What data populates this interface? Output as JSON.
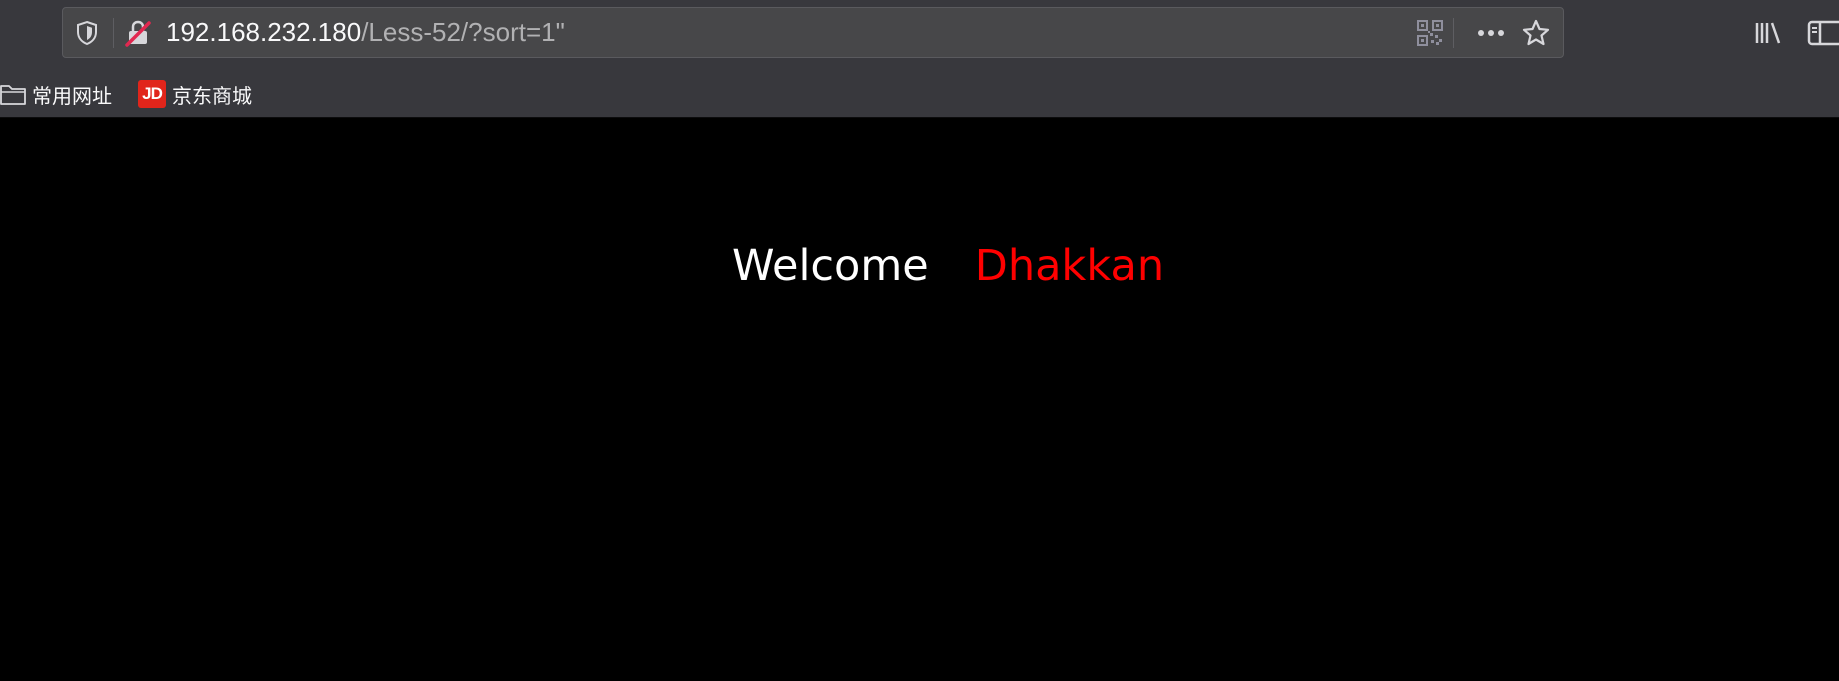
{
  "browser": {
    "url_host": "192.168.232.180",
    "url_path": "/Less-52/?sort=1\"",
    "icons": {
      "tracking_protection": "shield-icon",
      "insecure_connection": "lock-crossed-icon",
      "qr_code": "qr-code-icon",
      "page_actions": "more-icon",
      "bookmark_star": "star-icon",
      "library": "library-icon",
      "sidebar": "sidebar-icon"
    }
  },
  "bookmarks": [
    {
      "label": "常用网址",
      "icon": "folder-icon"
    },
    {
      "label": "京东商城",
      "icon": "jd-logo",
      "logo_text": "JD"
    }
  ],
  "page": {
    "welcome_text": "Welcome",
    "user_name": "Dhakkan"
  },
  "colors": {
    "toolbar_bg": "#38383d",
    "urlbar_bg": "#474749",
    "page_bg": "#000000",
    "welcome_color": "#ffffff",
    "name_color": "#ff0000",
    "jd_brand": "#e1251b"
  }
}
